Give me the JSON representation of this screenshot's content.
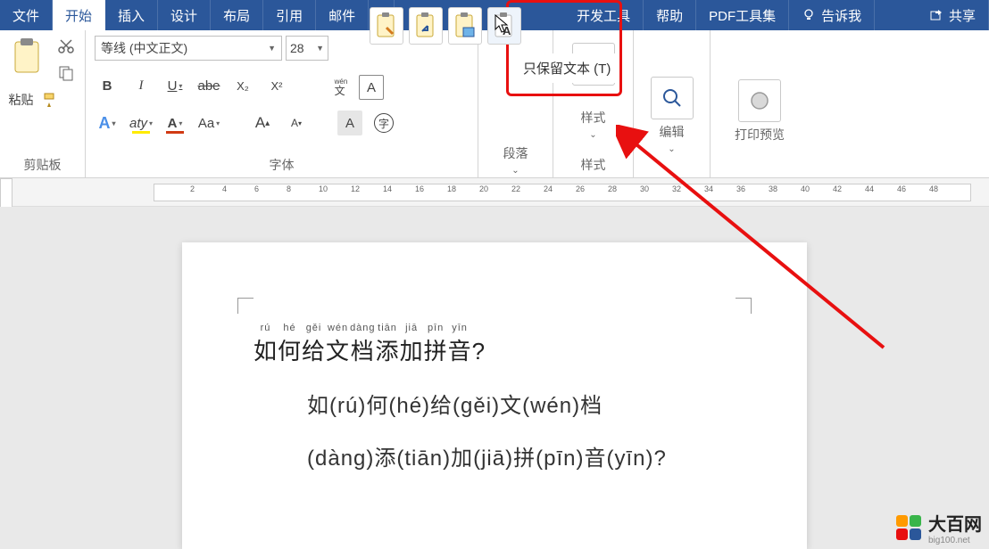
{
  "menu": {
    "file": "文件",
    "home": "开始",
    "insert": "插入",
    "design": "设计",
    "layout": "布局",
    "references": "引用",
    "mailings": "邮件",
    "devtools": "开发工具",
    "help": "帮助",
    "pdf": "PDF工具集",
    "tellme": "告诉我",
    "share": "共享"
  },
  "ribbon": {
    "clipboard": {
      "group": "剪贴板",
      "paste": "粘贴"
    },
    "font": {
      "group": "字体",
      "name": "等线 (中文正文)",
      "size": "28",
      "bold": "B",
      "italic": "I",
      "underline": "U",
      "strike": "abe",
      "sub": "X₂",
      "sup": "X²",
      "textfx": "A",
      "highlight": "aty",
      "fontcolor": "A",
      "case": "Aa",
      "grow": "A",
      "shrink": "A",
      "clear_a": "A",
      "char_border": "A",
      "circled": "字",
      "wen": "文",
      "box_a": "A"
    },
    "paragraph": {
      "group": "段落"
    },
    "styles": {
      "group": "样式",
      "label": "样式"
    },
    "editing": {
      "label": "编辑"
    },
    "preview": {
      "label": "打印预览"
    }
  },
  "paste_options": {
    "tooltip": "只保留文本 (T)"
  },
  "ruler": {
    "ticks": [
      "2",
      "4",
      "6",
      "8",
      "10",
      "12",
      "14",
      "16",
      "18",
      "20",
      "22",
      "24",
      "26",
      "28",
      "30",
      "32",
      "34",
      "36",
      "38",
      "40",
      "42",
      "44",
      "46",
      "48"
    ]
  },
  "document": {
    "line1_chars": [
      {
        "ch": "如",
        "py": "rú"
      },
      {
        "ch": "何",
        "py": "hé"
      },
      {
        "ch": "给",
        "py": "gěi"
      },
      {
        "ch": "文",
        "py": "wén"
      },
      {
        "ch": "档",
        "py": "dàng"
      },
      {
        "ch": "添",
        "py": "tiān"
      },
      {
        "ch": "加",
        "py": "jiā"
      },
      {
        "ch": "拼",
        "py": "pīn"
      },
      {
        "ch": "音",
        "py": "yīn"
      }
    ],
    "line1_tail": "?",
    "line2_segments": [
      {
        "ch": "如",
        "py": "rú"
      },
      {
        "ch": "何",
        "py": "hé"
      },
      {
        "ch": "给",
        "py": "gěi"
      },
      {
        "ch": "文",
        "py": "wén"
      },
      {
        "ch": "档",
        "py": ""
      }
    ],
    "line3_segments": [
      {
        "ch": "",
        "py": "dàng"
      },
      {
        "ch": "添",
        "py": "tiān"
      },
      {
        "ch": "加",
        "py": "jiā"
      },
      {
        "ch": "拼",
        "py": "pīn"
      },
      {
        "ch": "音",
        "py": "yīn"
      }
    ],
    "line3_tail": "?"
  },
  "watermark": {
    "name": "大百网",
    "url": "big100.net"
  },
  "colors": {
    "brand": "#2b579a",
    "red": "#e81010",
    "highlight_yellow": "#ffeb00",
    "fontcolor_red": "#d13a13",
    "textfx_blue": "#4a8fe8"
  }
}
